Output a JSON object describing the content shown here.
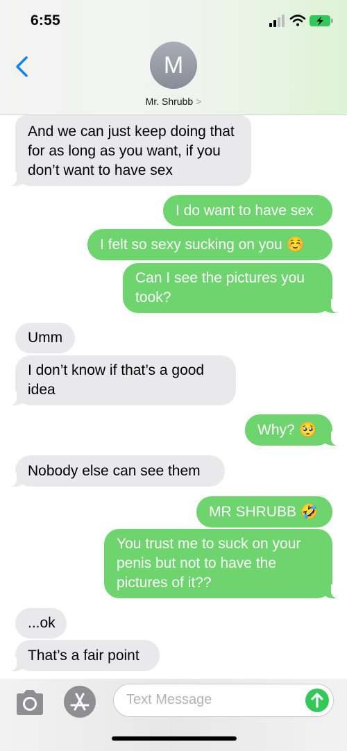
{
  "status_bar": {
    "time": "6:55"
  },
  "header": {
    "avatar_initial": "M",
    "contact_name": "Mr. Shrubb",
    "contact_chevron": ">"
  },
  "messages": [
    {
      "from": "contact",
      "text": "And we can just keep doing that for as long as you want, if you don’t want to have sex"
    },
    {
      "from": "me",
      "text": "I do want to have sex"
    },
    {
      "from": "me",
      "text": "I felt so sexy sucking on you ☺️"
    },
    {
      "from": "me",
      "text": "Can I see the pictures you took?"
    },
    {
      "from": "contact",
      "text": "Umm"
    },
    {
      "from": "contact",
      "text": "I don’t know if that’s a good idea"
    },
    {
      "from": "me",
      "text": "Why? 🥺"
    },
    {
      "from": "contact",
      "text": "Nobody else can see them"
    },
    {
      "from": "me",
      "text": "MR SHRUBB 🤣"
    },
    {
      "from": "me",
      "text": "You trust me to suck on your penis but not to have the pictures of it??"
    },
    {
      "from": "contact",
      "text": "...ok"
    },
    {
      "from": "contact",
      "text": "That’s a fair point"
    }
  ],
  "composer": {
    "placeholder": "Text Message",
    "icons": [
      "camera-icon",
      "app-store-icon",
      "send-arrow-icon"
    ]
  },
  "colors": {
    "sent_bubble": "#6dd46e",
    "received_bubble": "#e9e9eb",
    "ios_blue": "#0a84ff",
    "send_button": "#34c759"
  }
}
